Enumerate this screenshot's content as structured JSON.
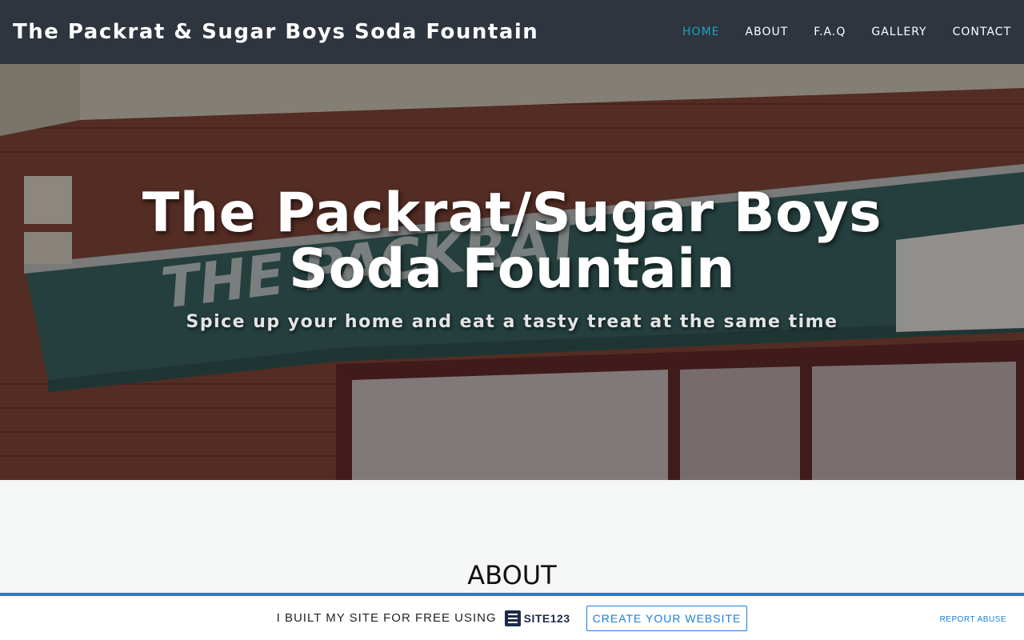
{
  "header": {
    "brand": "The Packrat & Sugar Boys Soda Fountain",
    "nav": [
      {
        "label": "HOME",
        "active": true
      },
      {
        "label": "ABOUT",
        "active": false
      },
      {
        "label": "F.A.Q",
        "active": false
      },
      {
        "label": "GALLERY",
        "active": false
      },
      {
        "label": "CONTACT",
        "active": false
      }
    ]
  },
  "hero": {
    "title": "The Packrat/Sugar Boys Soda Fountain",
    "subtitle": "Spice up your home and eat a tasty treat at the same time",
    "awning_text": "THE PACKRAT"
  },
  "about": {
    "heading": "ABOUT"
  },
  "promo": {
    "text": "I BUILT MY SITE FOR FREE USING",
    "logo_text": "SITE123",
    "cta_label": "CREATE YOUR WEBSITE",
    "report_label": "REPORT ABUSE"
  },
  "colors": {
    "header_bg": "#2f353f",
    "nav_active": "#1ba3c0",
    "accent_blue": "#1a7fd8",
    "awning_green": "#2e5a57"
  }
}
